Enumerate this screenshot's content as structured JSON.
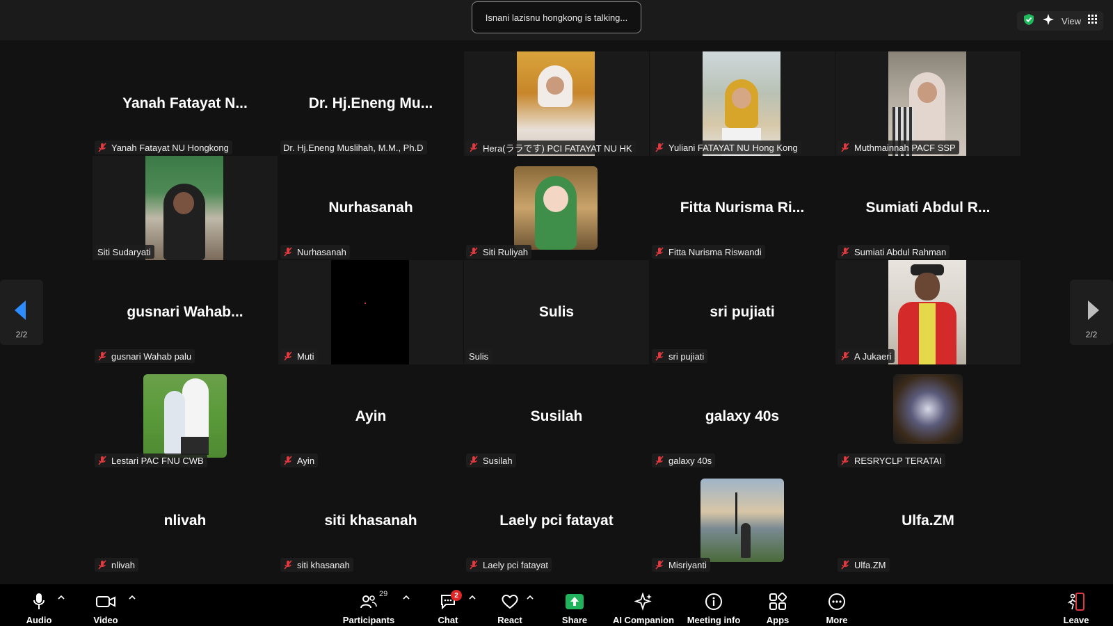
{
  "header": {
    "talking": "Isnani lazisnu hongkong is talking...",
    "view_label": "View"
  },
  "nav": {
    "page_left": "2/2",
    "page_right": "2/2"
  },
  "tiles": [
    {
      "big": "Yanah  Fatayat  N...",
      "tag": "Yanah Fatayat NU Hongkong"
    },
    {
      "big": "Dr.  Hj.Eneng  Mu...",
      "tag": "Dr. Hj.Eneng Muslihah, M.M., Ph.D"
    },
    {
      "big": "",
      "tag": "Hera(ララです) PCI FATAYAT NU HK"
    },
    {
      "big": "",
      "tag": "Yuliani FATAYAT NU Hong Kong"
    },
    {
      "big": "",
      "tag": "Muthmainnah PACF SSP"
    },
    {
      "big": "",
      "tag": "Siti Sudaryati"
    },
    {
      "big": "Nurhasanah",
      "tag": "Nurhasanah"
    },
    {
      "big": "",
      "tag": "Siti Ruliyah"
    },
    {
      "big": "Fitta  Nurisma  Ri...",
      "tag": "Fitta Nurisma Riswandi"
    },
    {
      "big": "Sumiati  Abdul  R...",
      "tag": "Sumiati Abdul Rahman"
    },
    {
      "big": "gusnari  Wahab...",
      "tag": "gusnari Wahab palu"
    },
    {
      "big": "",
      "tag": "Muti"
    },
    {
      "big": "Sulis",
      "tag": "Sulis"
    },
    {
      "big": "sri  pujiati",
      "tag": "sri pujiati"
    },
    {
      "big": "",
      "tag": "A Jukaeri"
    },
    {
      "big": "",
      "tag": "Lestari PAC FNU CWB"
    },
    {
      "big": "Ayin",
      "tag": "Ayin"
    },
    {
      "big": "Susilah",
      "tag": "Susilah"
    },
    {
      "big": "galaxy  40s",
      "tag": "galaxy 40s"
    },
    {
      "big": "",
      "tag": "RESRYCLP TERATAI"
    },
    {
      "big": "nlivah",
      "tag": "nlivah"
    },
    {
      "big": "siti  khasanah",
      "tag": "siti khasanah"
    },
    {
      "big": "Laely  pci  fatayat",
      "tag": "Laely pci fatayat"
    },
    {
      "big": "",
      "tag": "Misriyanti"
    },
    {
      "big": "Ulfa.ZM",
      "tag": "Ulfa.ZM"
    }
  ],
  "toolbar": {
    "audio": "Audio",
    "video": "Video",
    "participants": "Participants",
    "participants_count": "29",
    "chat": "Chat",
    "chat_badge": "2",
    "react": "React",
    "share": "Share",
    "ai_companion": "AI Companion",
    "meeting_info": "Meeting info",
    "apps": "Apps",
    "more": "More",
    "leave": "Leave"
  },
  "colors": {
    "accent_blue": "#2d8cff",
    "share_green": "#20b35b",
    "mute_red": "#e0393e",
    "shield_green": "#1fb85c"
  }
}
